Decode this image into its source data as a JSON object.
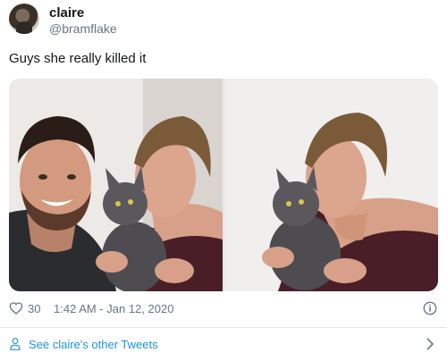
{
  "author": {
    "name": "claire",
    "handle": "@bramflake",
    "avatar_icon": "profile-photo"
  },
  "tweet": {
    "text": "Guys she really killed it"
  },
  "media": {
    "photos": [
      {
        "icon": "photo-selfie-with-kitten"
      },
      {
        "icon": "photo-woman-kissing-kitten"
      }
    ]
  },
  "meta": {
    "likes": "30",
    "timestamp": "1:42 AM - Jan 12, 2020"
  },
  "footer": {
    "more_tweets_label": "See claire's other Tweets"
  },
  "colors": {
    "link": "#1b95e0",
    "secondary_text": "#657786",
    "divider": "#e1e8ed"
  }
}
